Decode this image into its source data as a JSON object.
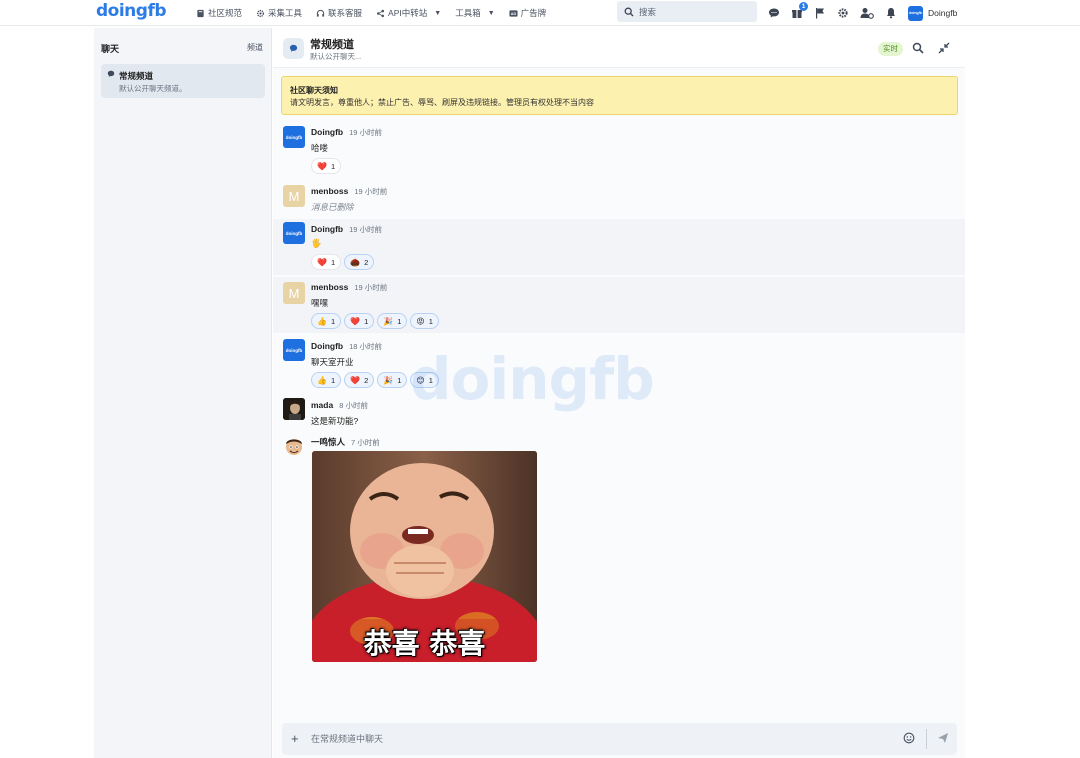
{
  "brand": {
    "logo": "doingfb",
    "watermark": "doingfb"
  },
  "nav": {
    "items": [
      {
        "label": "社区规范",
        "icon": "book-icon"
      },
      {
        "label": "采集工具",
        "icon": "gear-icon"
      },
      {
        "label": "联系客服",
        "icon": "headset-icon"
      },
      {
        "label": "API中转站",
        "icon": "share-icon",
        "dropdown": true
      },
      {
        "label": "工具箱",
        "icon": "",
        "dropdown": true
      },
      {
        "label": "广告牌",
        "icon": "ad-icon"
      }
    ],
    "search_placeholder": "搜索",
    "gift_badge": "1",
    "username": "Doingfb",
    "mini_logo": "doingfb"
  },
  "sidebar": {
    "title": "聊天",
    "link": "频道",
    "channel": {
      "name": "常规频道",
      "desc": "默认公开聊天频道。"
    }
  },
  "channel_header": {
    "name": "常规频道",
    "desc": "默认公开聊天...",
    "live": "实时"
  },
  "notice": {
    "title": "社区聊天须知",
    "body": "请文明发言，尊重他人；禁止广告、辱骂、刷屏及违规链接。管理员有权处理不当内容"
  },
  "messages": [
    {
      "user": "Doingfb",
      "time": "19 小时前",
      "text": "哈喽",
      "reactions": [
        {
          "emoji": "❤️",
          "count": "1"
        }
      ]
    },
    {
      "user": "menboss",
      "time": "19 小时前",
      "text": "消息已删除"
    },
    {
      "user": "Doingfb",
      "time": "19 小时前",
      "text": "🖐",
      "reactions": [
        {
          "emoji": "❤️",
          "count": "1"
        },
        {
          "emoji": "🌰",
          "count": "2"
        }
      ]
    },
    {
      "user": "menboss",
      "time": "19 小时前",
      "text": "嘿嘿",
      "reactions": [
        {
          "emoji": "👍",
          "count": "1"
        },
        {
          "emoji": "❤️",
          "count": "1"
        },
        {
          "emoji": "🎉",
          "count": "1"
        },
        {
          "emoji": "😡",
          "count": "1"
        }
      ]
    },
    {
      "user": "Doingfb",
      "time": "18 小时前",
      "text": "聊天室开业",
      "reactions": [
        {
          "emoji": "👍",
          "count": "1"
        },
        {
          "emoji": "❤️",
          "count": "2"
        },
        {
          "emoji": "🎉",
          "count": "1"
        },
        {
          "emoji": "😊",
          "count": "1"
        }
      ]
    },
    {
      "user": "mada",
      "time": "8 小时前",
      "text": "这是新功能?"
    },
    {
      "user": "一鸣惊人",
      "time": "7 小时前",
      "gif_caption": "恭喜 恭喜"
    }
  ],
  "composer": {
    "placeholder": "在常规频道中聊天"
  },
  "colors": {
    "accent": "#2d7be5",
    "notice_bg": "#fdf1b0",
    "live_bg": "#e4f5d2"
  }
}
